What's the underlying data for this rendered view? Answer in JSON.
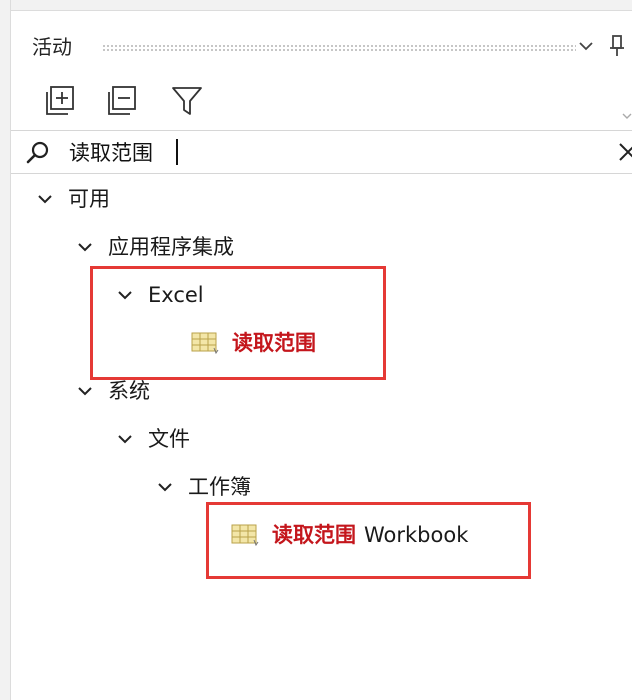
{
  "panel": {
    "title": "活动"
  },
  "toolbar": {
    "expand_all": "expand-all-icon",
    "collapse_all": "collapse-all-icon",
    "filter": "filter-icon"
  },
  "search": {
    "value": "读取范围",
    "placeholder": ""
  },
  "tree": {
    "available": "可用",
    "app_integration": "应用程序集成",
    "excel": "Excel",
    "excel_read_range": "读取范围",
    "system": "系统",
    "file": "文件",
    "workbook": "工作簿",
    "workbook_read_range": "读取范围",
    "workbook_suffix": "Workbook"
  },
  "colors": {
    "highlight": "#c4161c",
    "annotation_box": "#e53935"
  }
}
